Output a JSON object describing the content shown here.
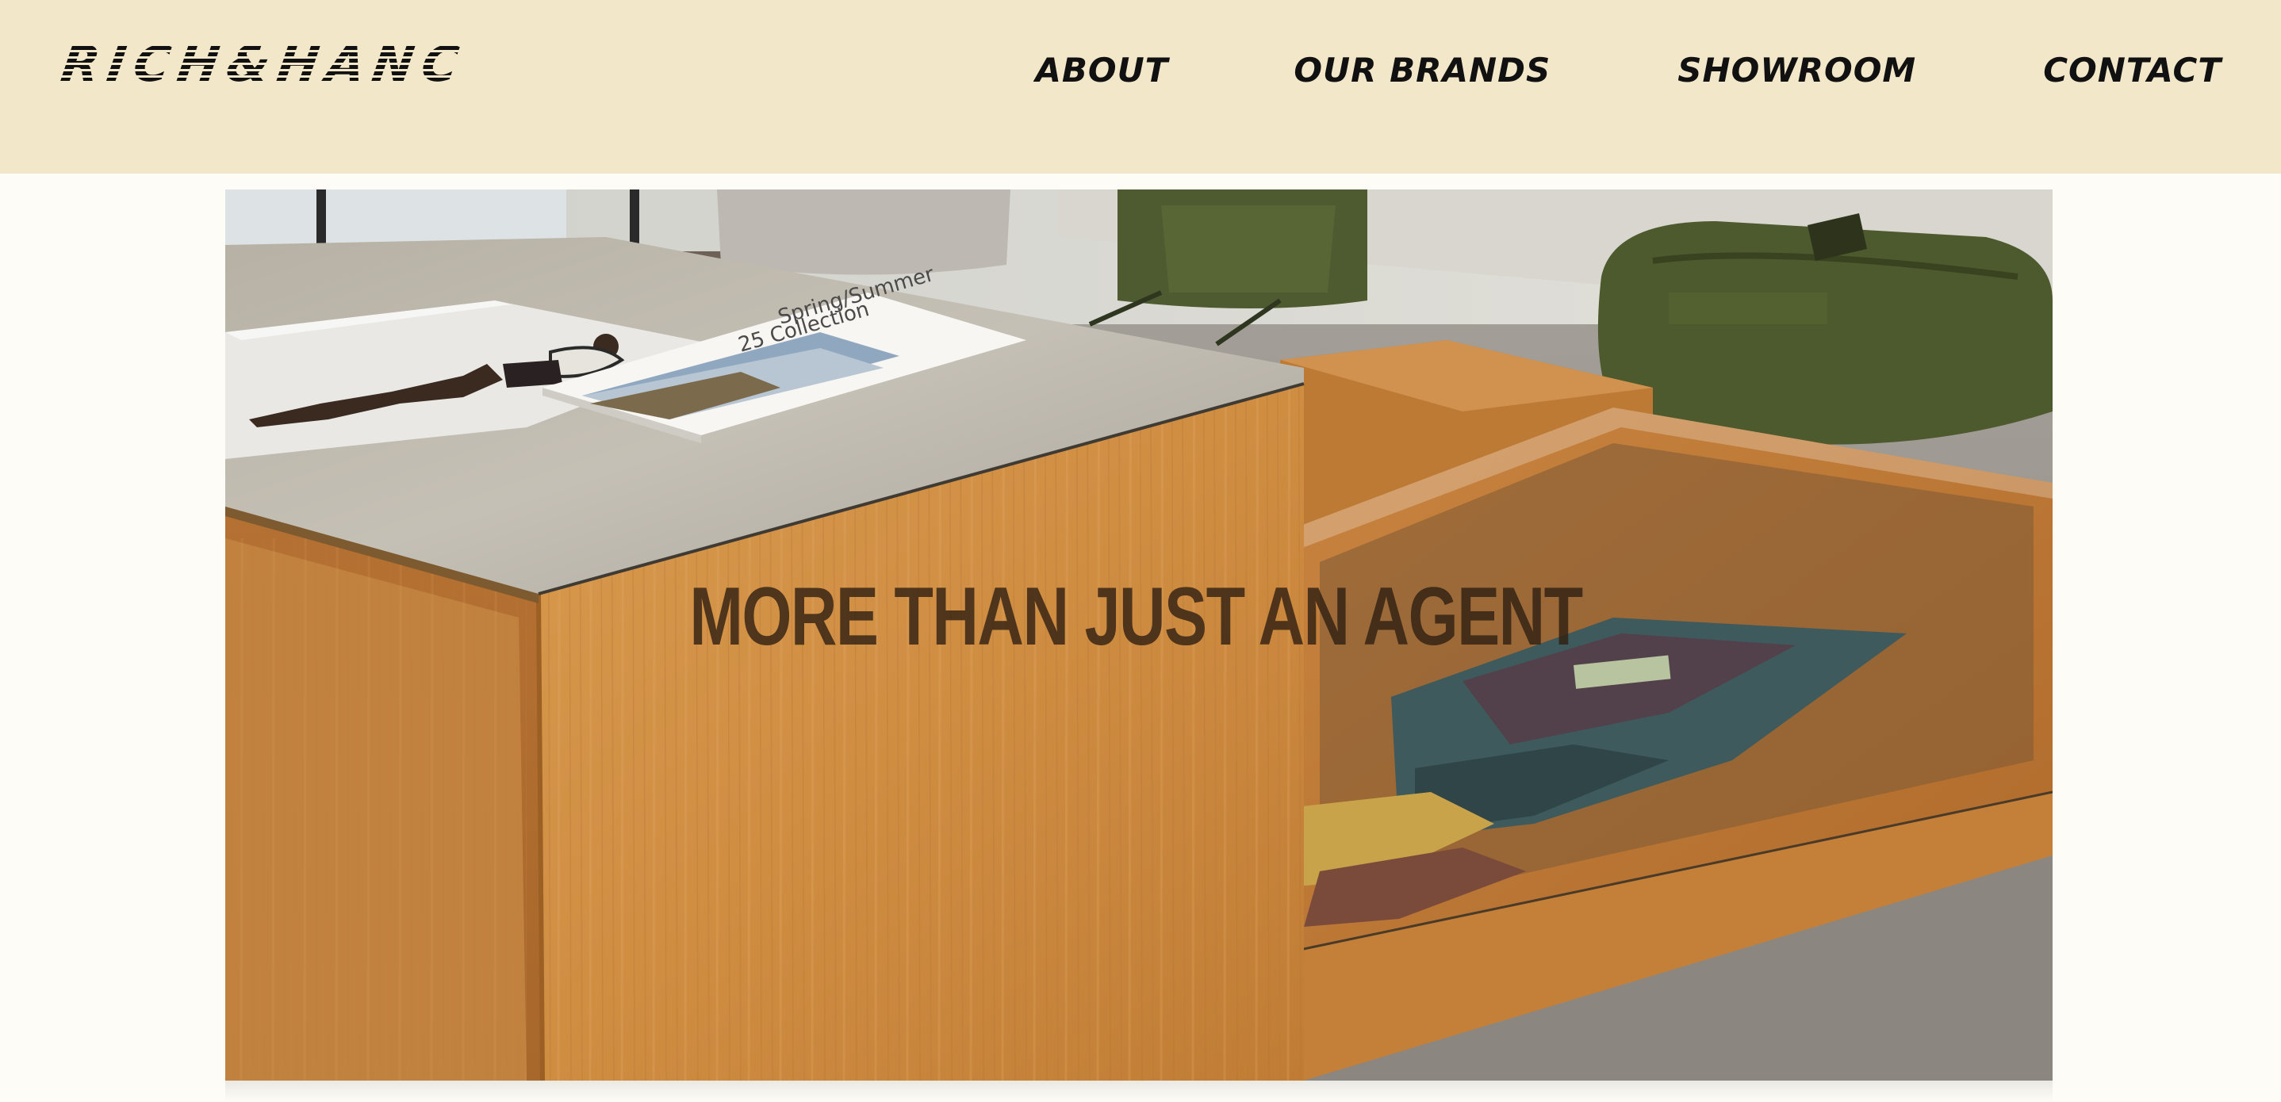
{
  "header": {
    "logo_text": "RICH&HANC",
    "nav": [
      {
        "label": "ABOUT"
      },
      {
        "label": "OUR BRANDS"
      },
      {
        "label": "SHOWROOM"
      },
      {
        "label": "CONTACT"
      }
    ]
  },
  "hero": {
    "title": "MORE THAN JUST AN AGENT",
    "brochure_text": "Spring/Summer 25 Collection",
    "image_alt": "Showroom with wooden display table, glass display case and green bags"
  },
  "colors": {
    "header_bg": "#f3e7c9",
    "page_bg": "#fdfcf6",
    "nav_text": "#111111",
    "hero_title": "#3a2716"
  }
}
